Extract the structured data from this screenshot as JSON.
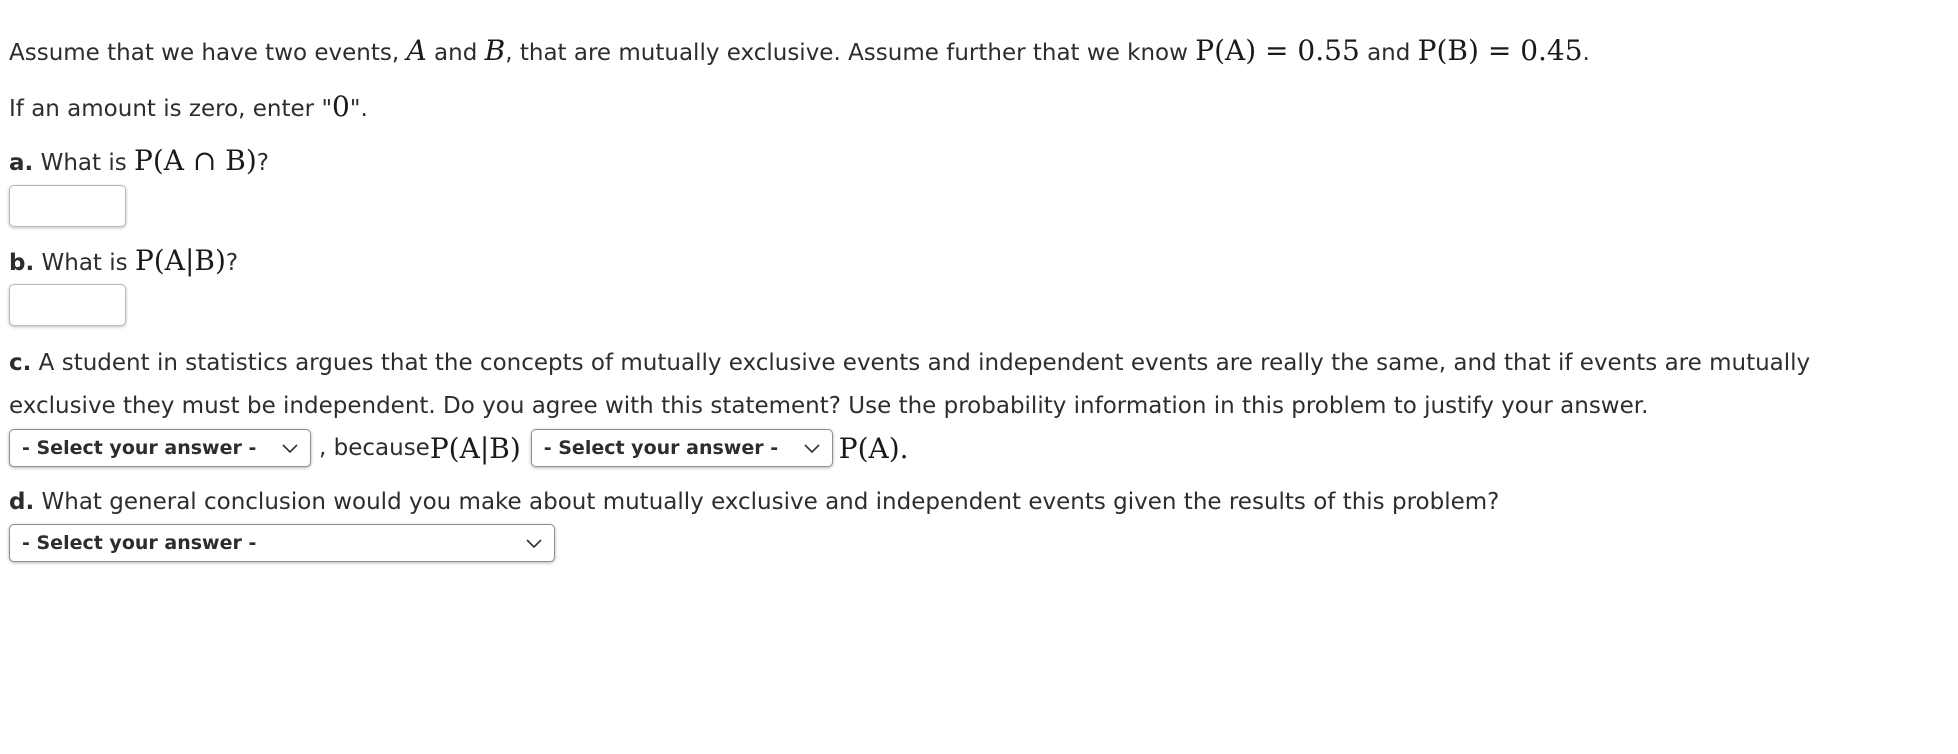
{
  "intro": {
    "text_before_a": "Assume that we have two events, ",
    "event_a": "A",
    "text_and": " and ",
    "event_b": "B",
    "text_after_b": ", that are mutually exclusive. Assume further that we know ",
    "pa_expr": "P(A) = 0.55",
    "text_and2": " and ",
    "pb_expr": "P(B) = 0.45",
    "text_end": "."
  },
  "zero_note": {
    "text": "If an amount is zero, enter \"",
    "zero": "0",
    "text_end": "\"."
  },
  "question_a": {
    "label": "a.",
    "text": " What is ",
    "expr": "P(A ∩ B)",
    "end": "?",
    "input_value": "",
    "input_placeholder": ""
  },
  "question_b": {
    "label": "b.",
    "text": " What is ",
    "expr": "P(A|B)",
    "end": "?",
    "input_value": "",
    "input_placeholder": ""
  },
  "question_c": {
    "label": "c.",
    "line1": " A student in statistics argues that the concepts of mutually exclusive events and independent events are really the same, and that if events are mutually",
    "line2": "exclusive they must be independent. Do you agree with this statement? Use the probability information in this problem to justify your answer.",
    "select1_value": "- Select your answer -",
    "because_text": ", because ",
    "expr1": "P(A|B)",
    "select2_value": "- Select your answer -",
    "expr2": "P(A).",
    "chevron_icon": "chevron-down-icon"
  },
  "question_d": {
    "label": "d.",
    "text": " What general conclusion would you make about mutually exclusive and independent events given the results of this problem?",
    "select_value": "- Select your answer -",
    "chevron_icon": "chevron-down-icon"
  }
}
